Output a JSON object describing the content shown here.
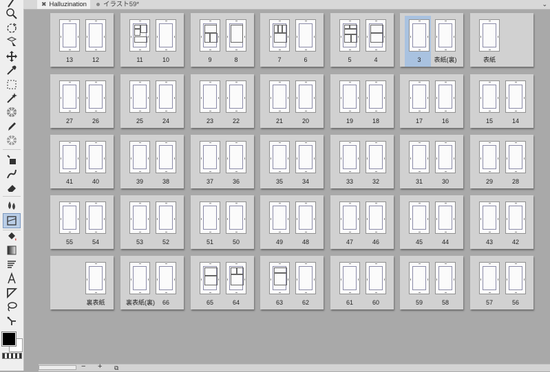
{
  "tabs": [
    {
      "label": "Halluzination",
      "active": true,
      "close_icon": "close-icon"
    },
    {
      "label": "イラスト59*",
      "active": false,
      "modified_icon": "dot-icon"
    }
  ],
  "tab_menu_icon": "chevron-down-icon",
  "toolbar": {
    "tools": [
      "pen-icon",
      "zoom-icon",
      "rotate-icon",
      "object-select-icon",
      "move-icon",
      "eyedropper-icon",
      "rect-select-icon",
      "magic-wand-icon",
      "decoration-icon",
      "pen-tool-icon",
      "airbrush-icon",
      "fill-icon",
      "blend-icon",
      "eraser-icon",
      "watercolor-icon",
      "frame-border-icon",
      "fill-bucket-icon",
      "gradient-icon",
      "balloon-icon",
      "text-icon",
      "ruler-icon",
      "lasso-icon",
      "correct-line-icon"
    ],
    "active_tool": "frame-border-icon",
    "colors": {
      "foreground": "#000000",
      "background": "#ffffff"
    }
  },
  "spreads": [
    [
      {
        "left": "13",
        "right": "12"
      },
      {
        "left": "11",
        "right": "10"
      },
      {
        "left": "9",
        "right": "8"
      },
      {
        "left": "7",
        "right": "6"
      },
      {
        "left": "5",
        "right": "4"
      },
      {
        "left": "3",
        "right": "表紙(裏)"
      },
      {
        "left": "表紙",
        "right": ""
      }
    ],
    [
      {
        "left": "27",
        "right": "26"
      },
      {
        "left": "25",
        "right": "24"
      },
      {
        "left": "23",
        "right": "22"
      },
      {
        "left": "21",
        "right": "20"
      },
      {
        "left": "19",
        "right": "18"
      },
      {
        "left": "17",
        "right": "16"
      },
      {
        "left": "15",
        "right": "14"
      }
    ],
    [
      {
        "left": "41",
        "right": "40"
      },
      {
        "left": "39",
        "right": "38"
      },
      {
        "left": "37",
        "right": "36"
      },
      {
        "left": "35",
        "right": "34"
      },
      {
        "left": "33",
        "right": "32"
      },
      {
        "left": "31",
        "right": "30"
      },
      {
        "left": "29",
        "right": "28"
      }
    ],
    [
      {
        "left": "55",
        "right": "54"
      },
      {
        "left": "53",
        "right": "52"
      },
      {
        "left": "51",
        "right": "50"
      },
      {
        "left": "49",
        "right": "48"
      },
      {
        "left": "47",
        "right": "46"
      },
      {
        "left": "45",
        "right": "44"
      },
      {
        "left": "43",
        "right": "42"
      }
    ],
    [
      {
        "left": "",
        "right": "裏表紙"
      },
      {
        "left": "裏表紙(裏)",
        "right": "66"
      },
      {
        "left": "65",
        "right": "64"
      },
      {
        "left": "63",
        "right": "62"
      },
      {
        "left": "61",
        "right": "60"
      },
      {
        "left": "59",
        "right": "58"
      },
      {
        "left": "57",
        "right": "56"
      }
    ]
  ],
  "selected_page": "3",
  "bottombar": {
    "zoom_out": "−",
    "zoom_in": "+",
    "fit_icon": "fit-page-icon"
  }
}
